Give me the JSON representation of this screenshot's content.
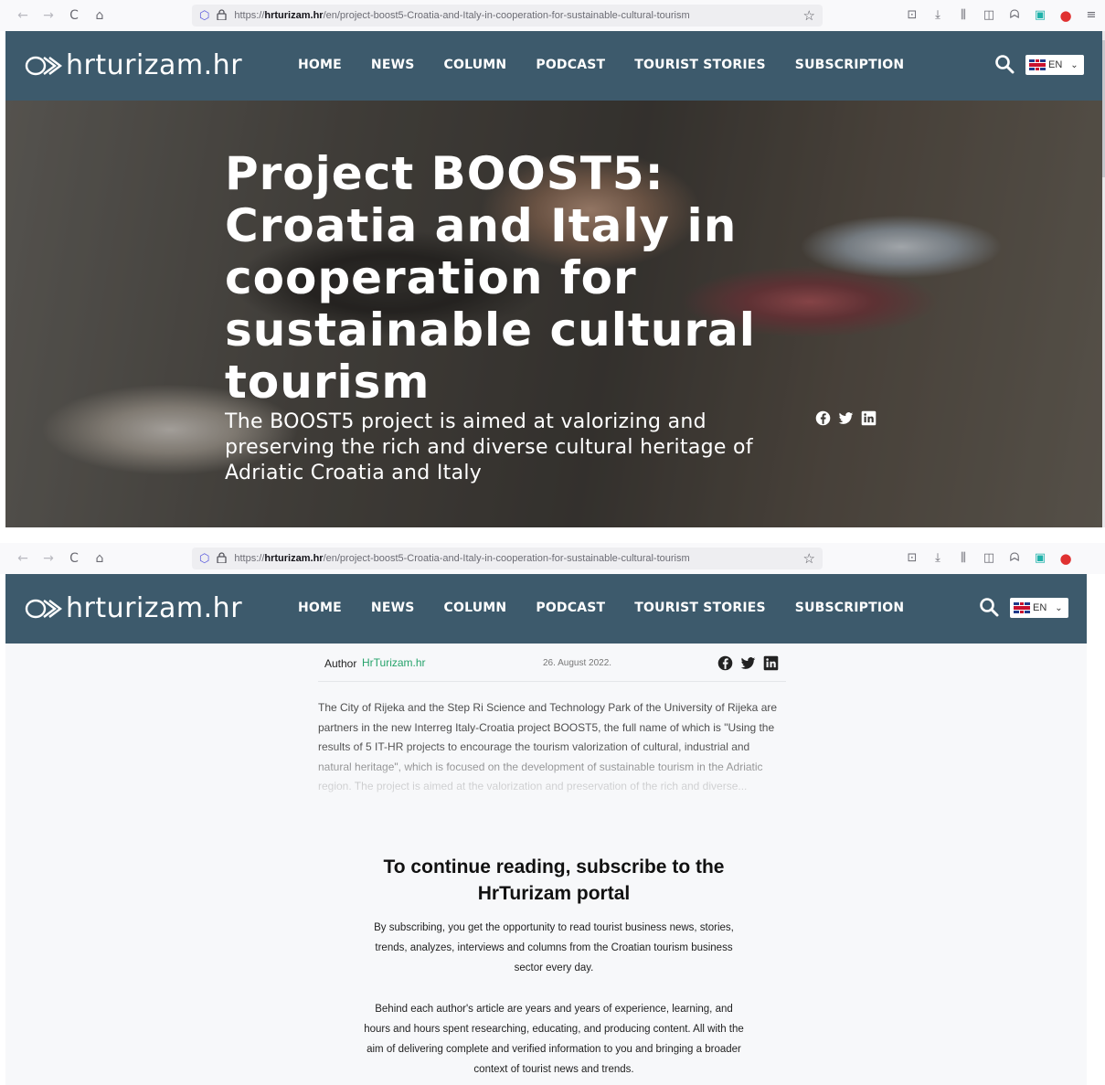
{
  "browser": {
    "url_prefix": "https://",
    "url_domain": "hrturizam.hr",
    "url_path": "/en/project-boost5-Croatia-and-Italy-in-cooperation-for-sustainable-cultural-tourism",
    "nav": {
      "back": "←",
      "forward": "→",
      "reload": "C",
      "home": "⌂"
    },
    "tools": {
      "pocket": "⊡",
      "download": "⤓",
      "library": "⫼",
      "sidebar": "◫",
      "account": "ᗣ",
      "save": "▣",
      "extension": "●",
      "menu": "≡"
    },
    "star": "☆",
    "shield": "⬡",
    "lock": "🔒"
  },
  "site": {
    "logo_text": "hrturizam.hr",
    "menu": [
      "HOME",
      "NEWS",
      "COLUMN",
      "PODCAST",
      "TOURIST STORIES",
      "SUBSCRIPTION"
    ],
    "language": "EN",
    "lang_chevron": "⌄"
  },
  "hero": {
    "title": "Project BOOST5: Croatia and Italy in cooperation for sustainable cultural tourism",
    "subtitle": "The BOOST5 project is aimed at valorizing and preserving the rich and diverse cultural heritage of Adriatic Croatia and Italy"
  },
  "article": {
    "author_label": "Author",
    "author_name": "HrTurizam.hr",
    "date": "26. August 2022.",
    "excerpt": "The City of Rijeka and the Step Ri Science and Technology Park of the University of Rijeka are partners in the new Interreg Italy-Croatia project BOOST5, the full name of which is \"Using the results of 5 IT-HR projects to encourage the tourism valorization of cultural, industrial and natural heritage\", which is focused on the development of sustainable tourism in the Adriatic region. The project is aimed at the valorization and preservation of the rich and diverse..."
  },
  "paywall": {
    "title": "To continue reading, subscribe to the HrTurizam portal",
    "p1": "By subscribing, you get the opportunity to read tourist business news, stories, trends, analyzes, interviews and columns from the Croatian tourism business sector every day.",
    "p2": "Behind each author's article are years and years of experience, learning, and hours and hours spent researching, educating, and producing content. All with the aim of delivering complete and verified information to you and bringing a broader context of tourist news and trends."
  },
  "colors": {
    "header_bg": "#3d5a6c",
    "author_link": "#26a36b",
    "page_bg": "#f7f8fa"
  }
}
